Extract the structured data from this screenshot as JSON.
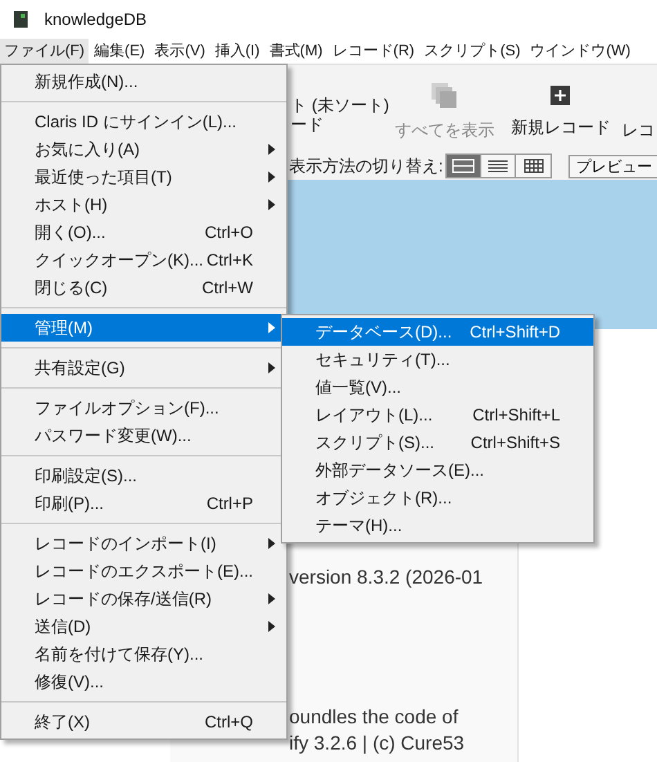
{
  "window": {
    "title": "knowledgeDB"
  },
  "menu_bar": [
    {
      "label": "ファイル(F)",
      "selected": true
    },
    {
      "label": "編集(E)",
      "selected": false
    },
    {
      "label": "表示(V)",
      "selected": false
    },
    {
      "label": "挿入(I)",
      "selected": false
    },
    {
      "label": "書式(M)",
      "selected": false
    },
    {
      "label": "レコード(R)",
      "selected": false
    },
    {
      "label": "スクリプト(S)",
      "selected": false
    },
    {
      "label": "ウインドウ(W)",
      "selected": false
    }
  ],
  "toolbar": {
    "sort_status": [
      "ト (未ソート)",
      "ード"
    ],
    "buttons": [
      {
        "kind": "show-all",
        "label": "すべてを表示",
        "disabled": true
      },
      {
        "kind": "new-record",
        "label": "新規レコード",
        "disabled": false
      },
      {
        "kind": "clipped",
        "label": "レコ",
        "disabled": false
      }
    ]
  },
  "view_bar": {
    "label": "表示方法の切り替え:",
    "views": [
      {
        "kind": "form",
        "selected": true
      },
      {
        "kind": "list",
        "selected": false
      },
      {
        "kind": "table",
        "selected": false
      }
    ],
    "preview_button": "プレビュー"
  },
  "content": {
    "paragraphs": [
      [
        "version 8.3.2 (2026-01"
      ],
      [
        "oundles the code of",
        "ify 3.2.6 | (c) Cure53"
      ]
    ]
  },
  "file_menu": {
    "items": [
      {
        "kind": "item",
        "label": "新規作成(N)...",
        "highlighted": false,
        "submenu": false
      },
      {
        "kind": "separator"
      },
      {
        "kind": "item",
        "label": "Claris ID にサインイン(L)...",
        "highlighted": false,
        "submenu": false
      },
      {
        "kind": "item",
        "label": "お気に入り(A)",
        "highlighted": false,
        "submenu": true
      },
      {
        "kind": "item",
        "label": "最近使った項目(T)",
        "highlighted": false,
        "submenu": true
      },
      {
        "kind": "item",
        "label": "ホスト(H)",
        "highlighted": false,
        "submenu": true
      },
      {
        "kind": "item",
        "label": "開く(O)...",
        "shortcut": "Ctrl+O",
        "highlighted": false,
        "submenu": false
      },
      {
        "kind": "item",
        "label": "クイックオープン(K)...",
        "shortcut": "Ctrl+K",
        "highlighted": false,
        "submenu": false
      },
      {
        "kind": "item",
        "label": "閉じる(C)",
        "shortcut": "Ctrl+W",
        "highlighted": false,
        "submenu": false
      },
      {
        "kind": "separator"
      },
      {
        "kind": "item",
        "label": "管理(M)",
        "highlighted": true,
        "submenu": true
      },
      {
        "kind": "separator"
      },
      {
        "kind": "item",
        "label": "共有設定(G)",
        "highlighted": false,
        "submenu": true
      },
      {
        "kind": "separator"
      },
      {
        "kind": "item",
        "label": "ファイルオプション(F)...",
        "highlighted": false,
        "submenu": false
      },
      {
        "kind": "item",
        "label": "パスワード変更(W)...",
        "highlighted": false,
        "submenu": false
      },
      {
        "kind": "separator"
      },
      {
        "kind": "item",
        "label": "印刷設定(S)...",
        "highlighted": false,
        "submenu": false
      },
      {
        "kind": "item",
        "label": "印刷(P)...",
        "shortcut": "Ctrl+P",
        "highlighted": false,
        "submenu": false
      },
      {
        "kind": "separator"
      },
      {
        "kind": "item",
        "label": "レコードのインポート(I)",
        "highlighted": false,
        "submenu": true
      },
      {
        "kind": "item",
        "label": "レコードのエクスポート(E)...",
        "highlighted": false,
        "submenu": false
      },
      {
        "kind": "item",
        "label": "レコードの保存/送信(R)",
        "highlighted": false,
        "submenu": true
      },
      {
        "kind": "item",
        "label": "送信(D)",
        "highlighted": false,
        "submenu": true
      },
      {
        "kind": "item",
        "label": "名前を付けて保存(Y)...",
        "highlighted": false,
        "submenu": false
      },
      {
        "kind": "item",
        "label": "修復(V)...",
        "highlighted": false,
        "submenu": false
      },
      {
        "kind": "separator"
      },
      {
        "kind": "item",
        "label": "終了(X)",
        "shortcut": "Ctrl+Q",
        "highlighted": false,
        "submenu": false
      }
    ]
  },
  "manage_submenu": {
    "items": [
      {
        "kind": "item",
        "label": "データベース(D)...",
        "shortcut": "Ctrl+Shift+D",
        "highlighted": true,
        "submenu": false
      },
      {
        "kind": "item",
        "label": "セキュリティ(T)...",
        "highlighted": false,
        "submenu": false
      },
      {
        "kind": "item",
        "label": "値一覧(V)...",
        "highlighted": false,
        "submenu": false
      },
      {
        "kind": "item",
        "label": "レイアウト(L)...",
        "shortcut": "Ctrl+Shift+L",
        "highlighted": false,
        "submenu": false
      },
      {
        "kind": "item",
        "label": "スクリプト(S)...",
        "shortcut": "Ctrl+Shift+S",
        "highlighted": false,
        "submenu": false
      },
      {
        "kind": "item",
        "label": "外部データソース(E)...",
        "highlighted": false,
        "submenu": false
      },
      {
        "kind": "item",
        "label": "オブジェクト(R)...",
        "highlighted": false,
        "submenu": false
      },
      {
        "kind": "item",
        "label": "テーマ(H)...",
        "highlighted": false,
        "submenu": false
      }
    ]
  }
}
